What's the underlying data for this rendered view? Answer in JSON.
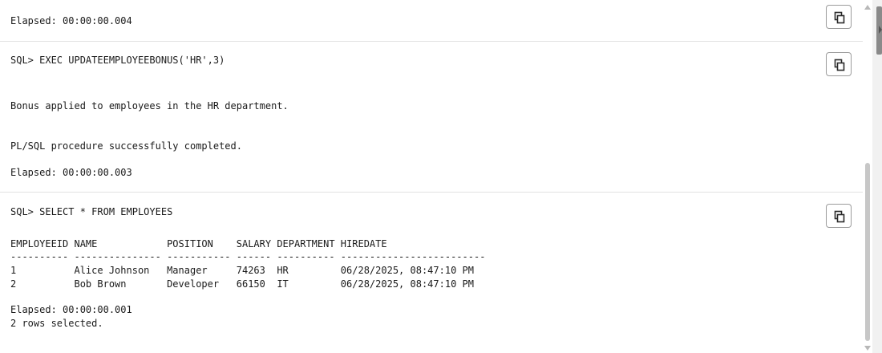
{
  "blocks": [
    {
      "lines": [
        "Elapsed: 00:00:00.004"
      ]
    },
    {
      "command": "SQL> EXEC UPDATEEMPLOYEEBONUS('HR',3)",
      "lines": [
        "Bonus applied to employees in the HR department.",
        "PL/SQL procedure successfully completed.",
        "Elapsed: 00:00:00.003"
      ]
    },
    {
      "command": "SQL> SELECT * FROM EMPLOYEES",
      "table": {
        "header": "EMPLOYEEID NAME            POSITION    SALARY DEPARTMENT HIREDATE",
        "separator": "---------- --------------- ----------- ------ ---------- -------------------------",
        "rows": [
          "1          Alice Johnson   Manager     74263  HR         06/28/2025, 08:47:10 PM",
          "2          Bob Brown       Developer   66150  IT         06/28/2025, 08:47:10 PM"
        ]
      },
      "lines": [
        "Elapsed: 00:00:00.001",
        "2 rows selected."
      ]
    }
  ],
  "icons": {
    "copy": "copy-icon"
  }
}
